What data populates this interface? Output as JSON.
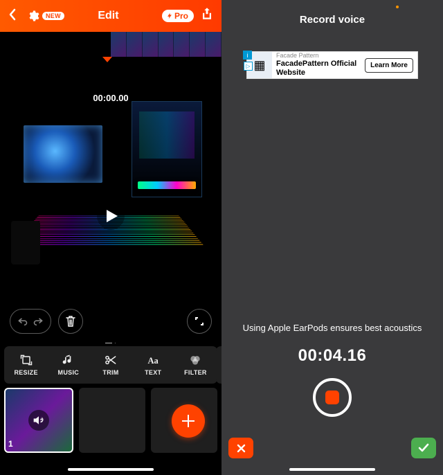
{
  "left": {
    "header": {
      "settings_badge": "NEW",
      "title": "Edit",
      "pro_label": "Pro"
    },
    "timecode": "00:00.00",
    "page_dots": "— ·",
    "tools": {
      "resize": "RESIZE",
      "music": "MUSIC",
      "trim": "TRIM",
      "text": "TEXT",
      "filter": "FILTER"
    },
    "clip_index": "1"
  },
  "right": {
    "title": "Record voice",
    "ad": {
      "category": "Facade Pattern",
      "headline": "FacadePattern Official Website",
      "cta": "Learn More",
      "info": "i",
      "tag": "▷"
    },
    "tip": "Using Apple EarPods ensures best acoustics",
    "timecode": "00:04.16"
  }
}
